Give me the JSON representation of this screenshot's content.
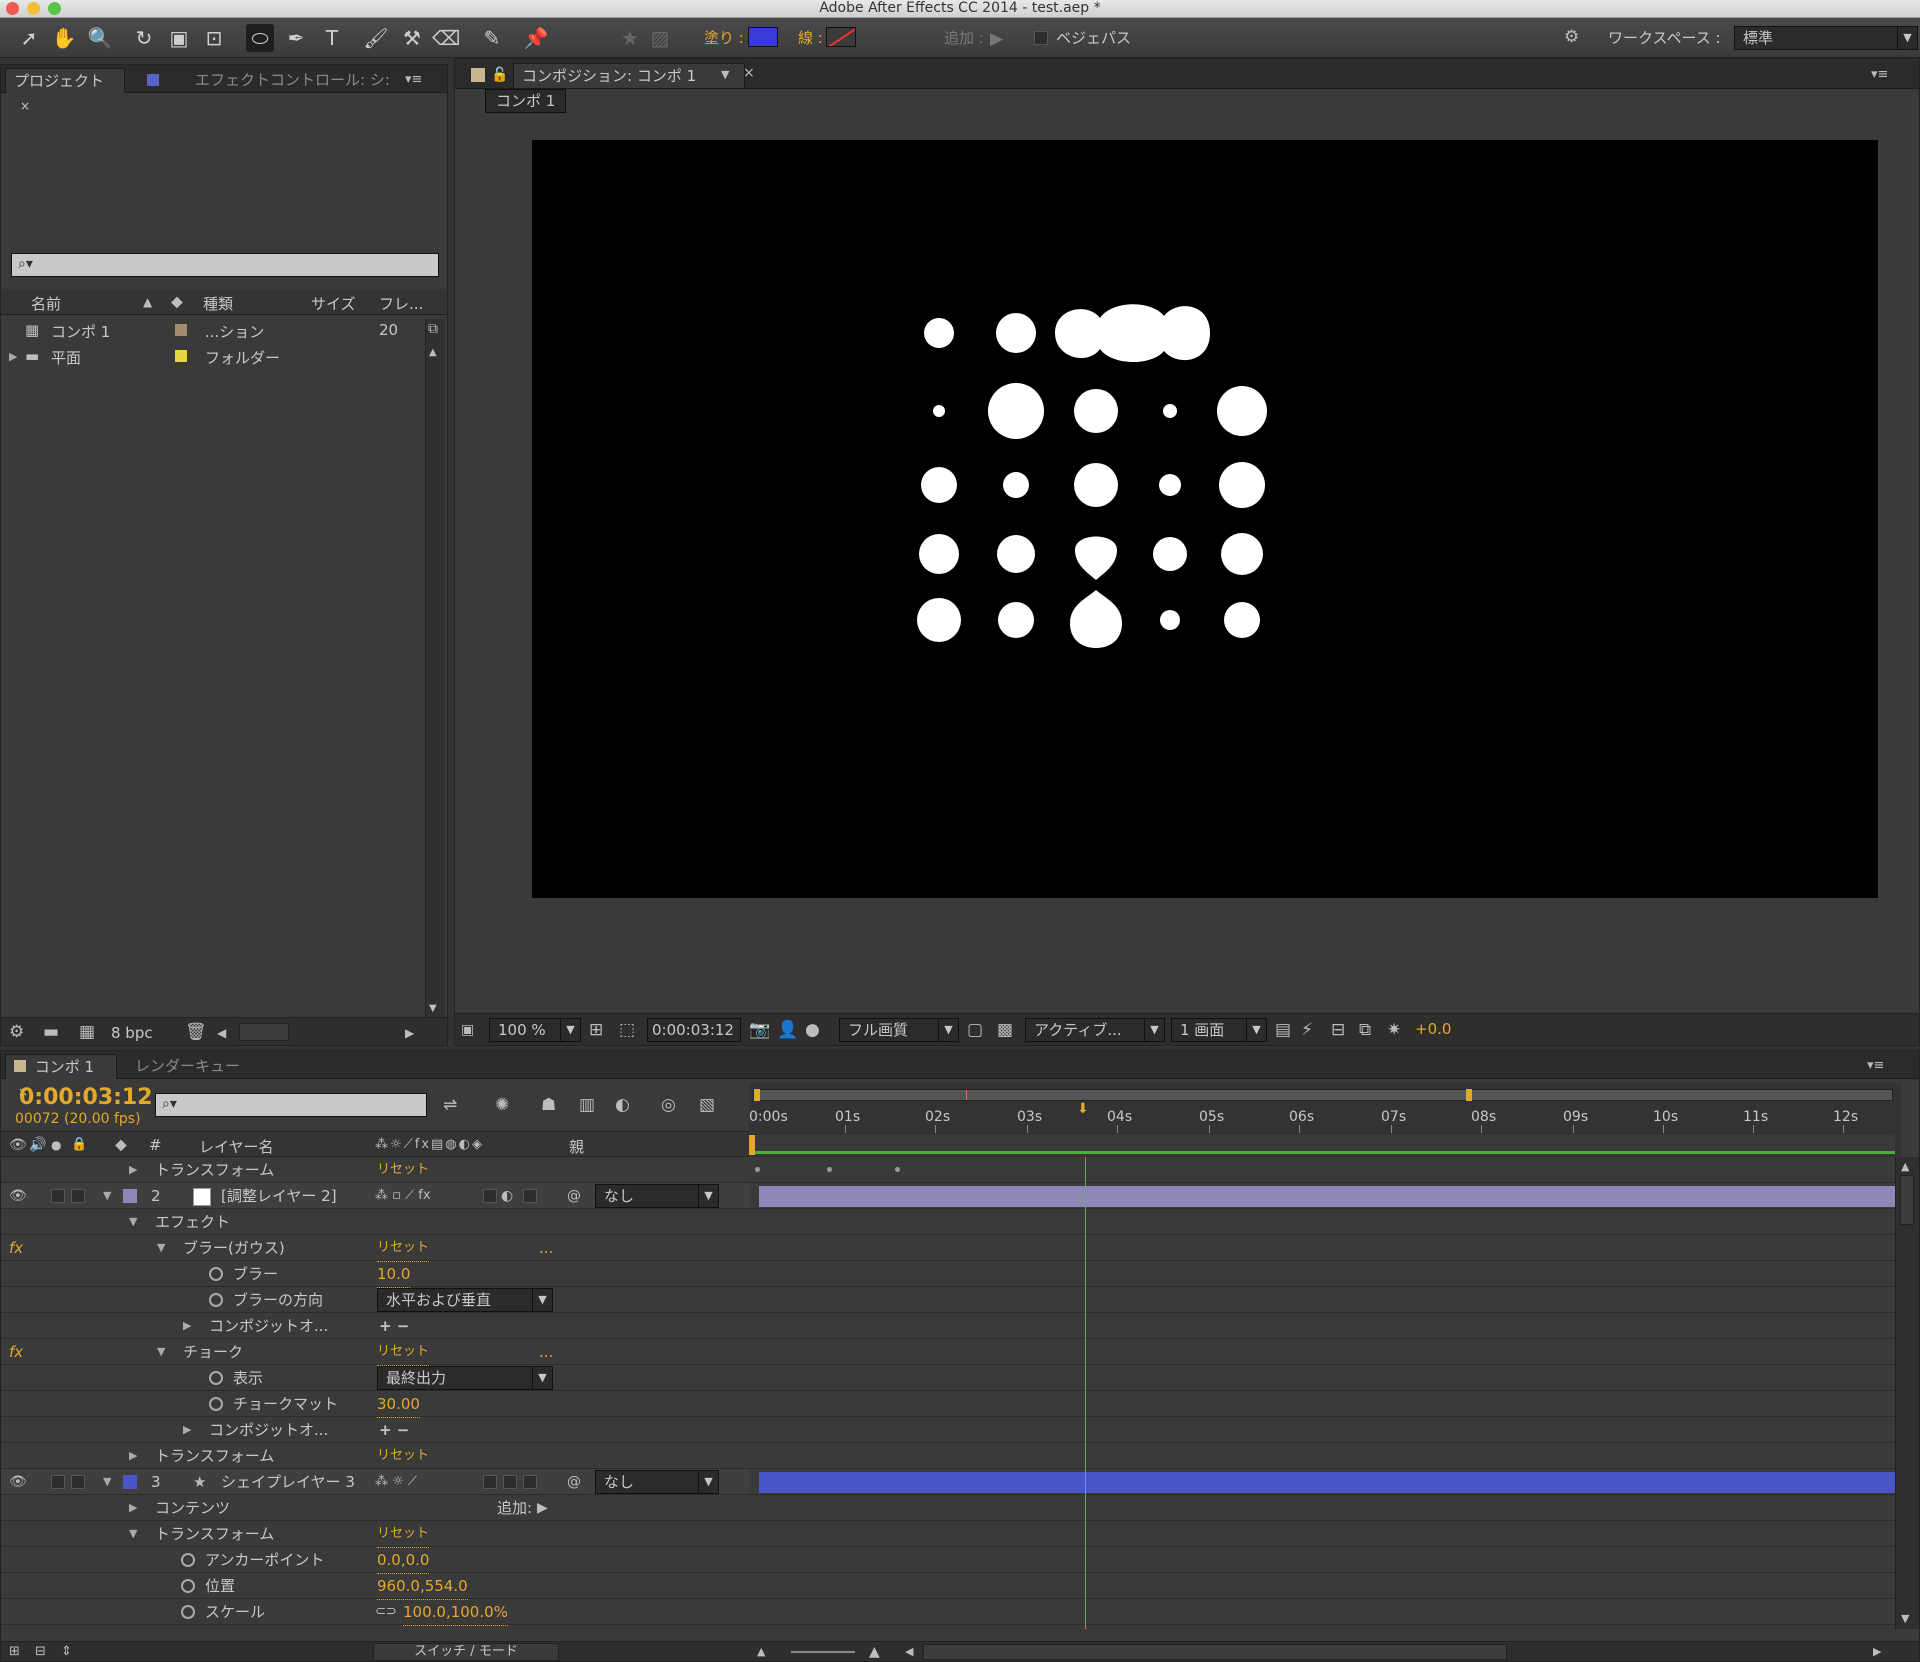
{
  "window": {
    "title": "Adobe After Effects CC 2014 - test.aep *"
  },
  "toolbar": {
    "fill_label": "塗り :",
    "stroke_label": "線 :",
    "add_label": "追加 :",
    "bezier_label": "ベジェパス",
    "workspace_label": "ワークスペース :",
    "workspace_value": "標準",
    "colors": {
      "fill": "#3a3ad8",
      "stroke": "#3b3b3b"
    }
  },
  "project_panel": {
    "tabs": [
      "プロジェクト",
      "エフェクトコントロール: シ:"
    ],
    "columns": {
      "name": "名前",
      "type": "種類",
      "size": "サイズ",
      "frame": "フレ..."
    },
    "items": [
      {
        "name": "コンポ 1",
        "type": "...ション",
        "size": "20",
        "color": "#a28c6e"
      },
      {
        "name": "平面",
        "type": "フォルダー",
        "size": "",
        "color": "#e6d440"
      }
    ],
    "bpc": "8 bpc"
  },
  "comp_viewer": {
    "tab": "コンポジション: コンポ 1",
    "breadcrumb": "コンポ 1",
    "zoom": "100 %",
    "timecode": "0:00:03:12",
    "quality": "フル画質",
    "camera": "アクティブ...",
    "views": "1 画面",
    "exposure": "+0.0"
  },
  "timeline": {
    "tabs": [
      "コンポ 1",
      "レンダーキュー"
    ],
    "timecode": "0:00:03:12",
    "frame_info": "00072 (20.00 fps)",
    "columns": {
      "number": "#",
      "layer_name": "レイヤー名",
      "parent": "親"
    },
    "ruler": [
      "0:00s",
      "01s",
      "02s",
      "03s",
      "04s",
      "05s",
      "06s",
      "07s",
      "08s",
      "09s",
      "10s",
      "11s",
      "12s"
    ],
    "rows": [
      {
        "label": "トランスフォーム",
        "value": "リセット"
      },
      {
        "num": "2",
        "label": "[調整レイヤー 2]",
        "parent": "なし"
      },
      {
        "label": "エフェクト"
      },
      {
        "label": "ブラー(ガウス)",
        "value": "リセット",
        "extra": "..."
      },
      {
        "label": "ブラー",
        "value": "10.0"
      },
      {
        "label": "ブラーの方向",
        "value": "水平および垂直"
      },
      {
        "label": "コンポジットオ...",
        "value": "+ −"
      },
      {
        "label": "チョーク",
        "value": "リセット",
        "extra": "..."
      },
      {
        "label": "表示",
        "value": "最終出力"
      },
      {
        "label": "チョークマット",
        "value": "30.00"
      },
      {
        "label": "コンポジットオ...",
        "value": "+ −"
      },
      {
        "label": "トランスフォーム",
        "value": "リセット"
      },
      {
        "num": "3",
        "label": "シェイプレイヤー 3",
        "parent": "なし"
      },
      {
        "label": "コンテンツ",
        "value": "追加:"
      },
      {
        "label": "トランスフォーム",
        "value": "リセット"
      },
      {
        "label": "アンカーポイント",
        "value": "0.0,0.0"
      },
      {
        "label": "位置",
        "value": "960.0,554.0"
      },
      {
        "label": "スケール",
        "value": "100.0,100.0%"
      }
    ],
    "switch_mode": "スイッチ / モード",
    "fx_label": "fx",
    "colors": {
      "layer2_bar": "#8e88b8",
      "layer3_bar": "#4a55c8",
      "work_area": "#4caf3c"
    }
  }
}
